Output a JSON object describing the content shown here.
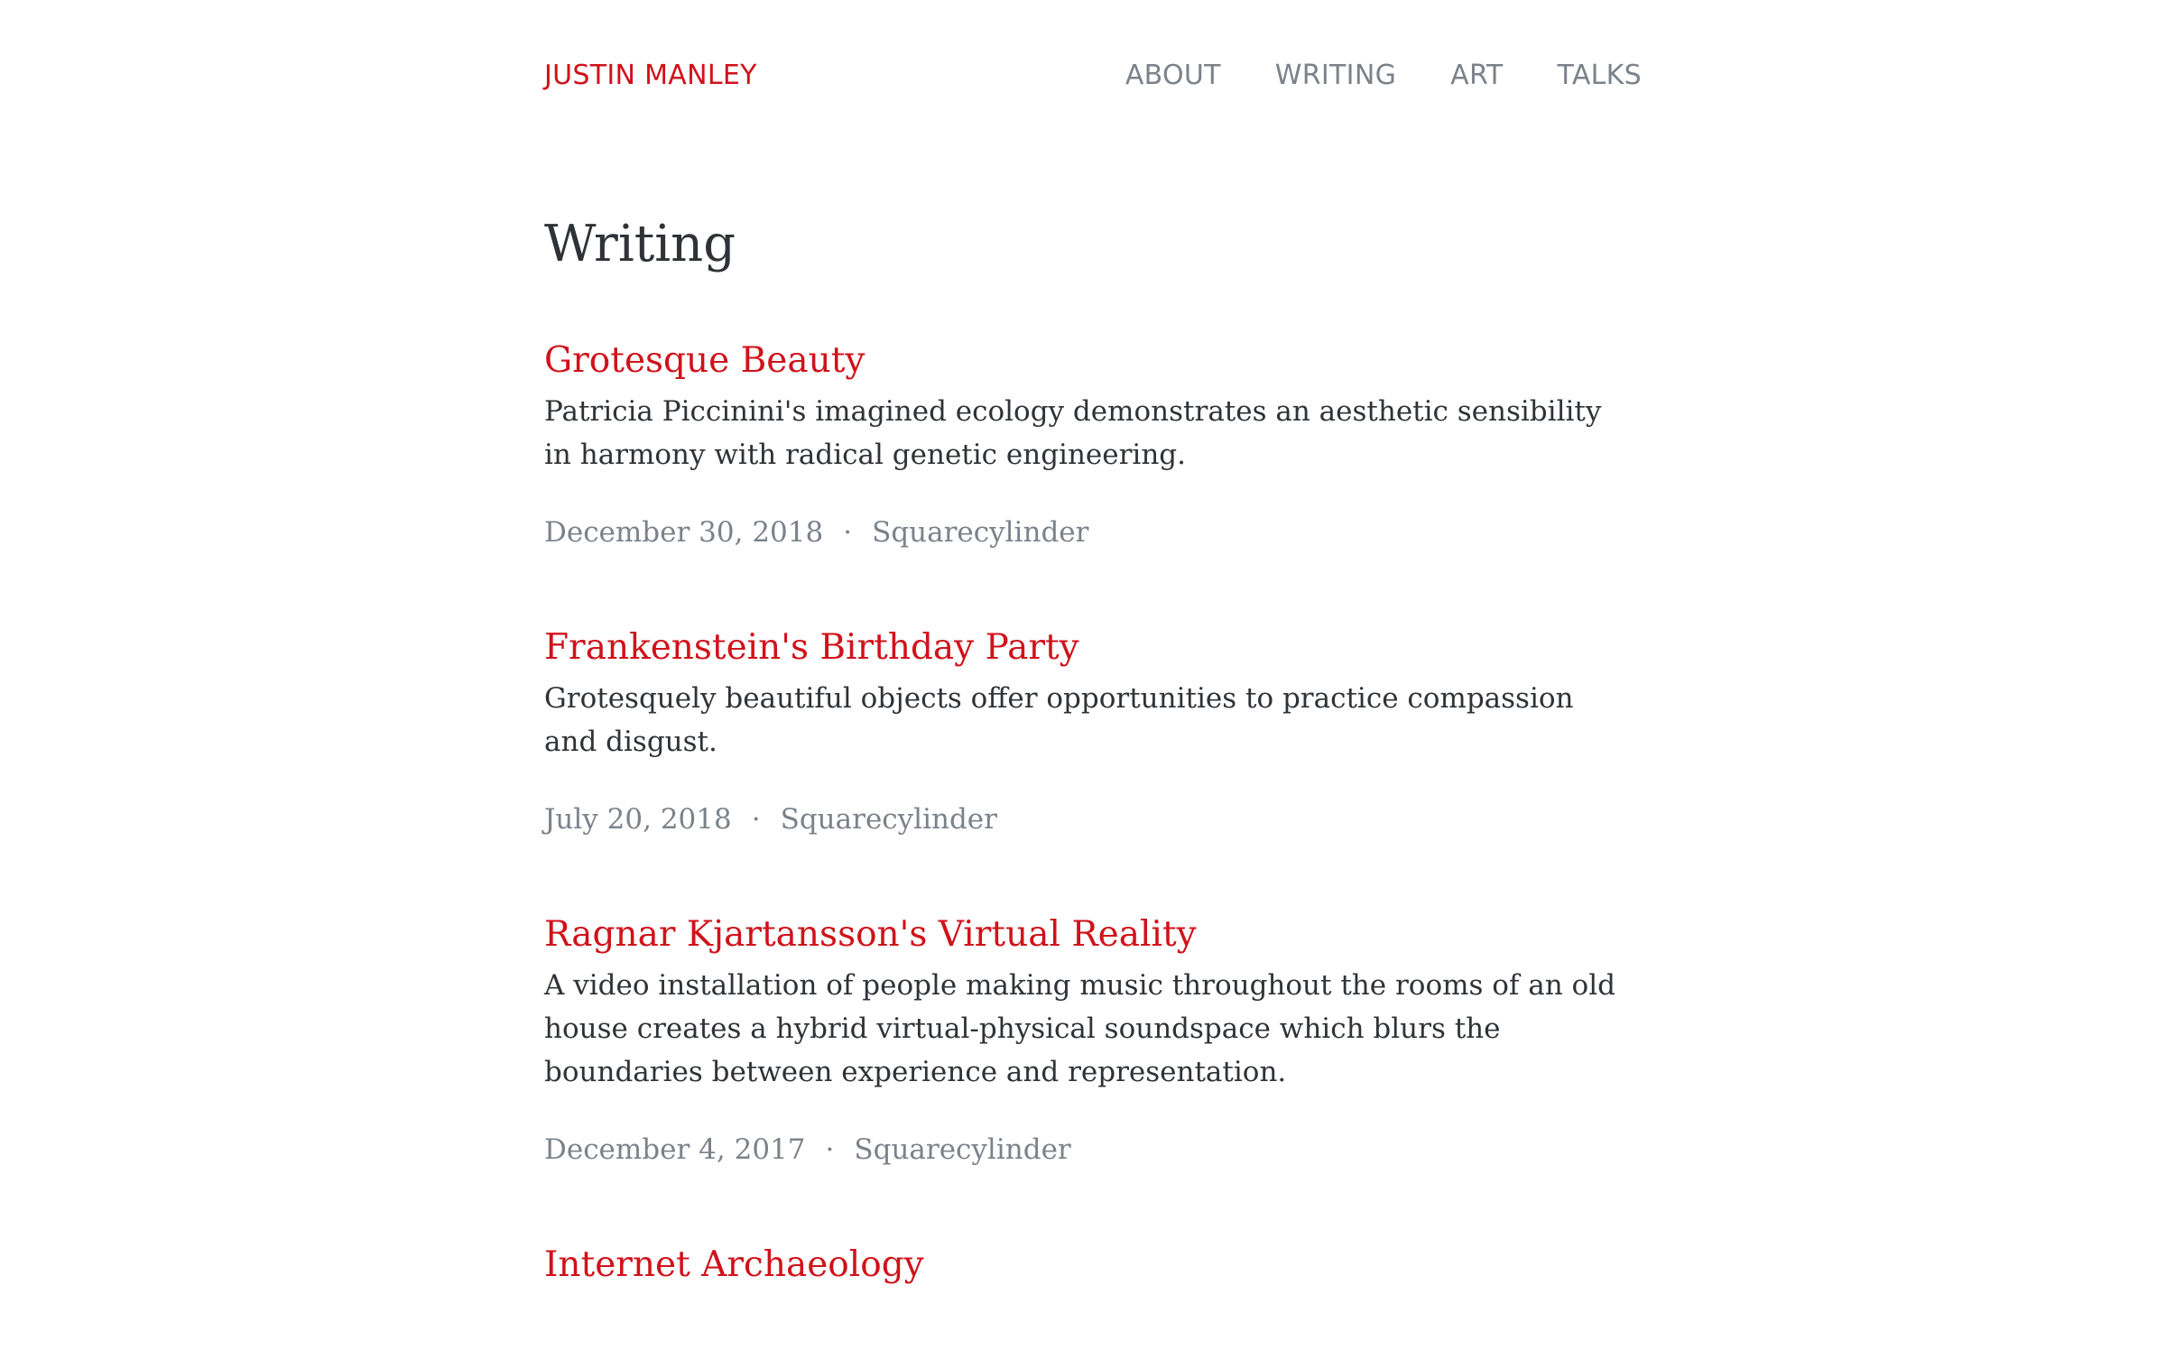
{
  "header": {
    "site_title": "JUSTIN MANLEY",
    "nav": [
      {
        "label": "ABOUT"
      },
      {
        "label": "WRITING"
      },
      {
        "label": "ART"
      },
      {
        "label": "TALKS"
      }
    ]
  },
  "main": {
    "page_title": "Writing",
    "posts": [
      {
        "title": "Grotesque Beauty",
        "excerpt": "Patricia Piccinini's imagined ecology demonstrates an aesthetic sensibility in harmony with radical genetic engineering.",
        "date": "December 30, 2018",
        "separator": "·",
        "source": "Squarecylinder"
      },
      {
        "title": "Frankenstein's Birthday Party",
        "excerpt": "Grotesquely beautiful objects offer opportunities to practice compassion and disgust.",
        "date": "July 20, 2018",
        "separator": "·",
        "source": "Squarecylinder"
      },
      {
        "title": "Ragnar Kjartansson's Virtual Reality",
        "excerpt": "A video installation of people making music throughout the rooms of an old house creates a hybrid virtual-physical soundspace which blurs the boundaries between experience and representation.",
        "date": "December 4, 2017",
        "separator": "·",
        "source": "Squarecylinder"
      },
      {
        "title": "Internet Archaeology"
      }
    ]
  },
  "colors": {
    "accent": "#d0121a",
    "text": "#2f3337",
    "muted": "#7b828a",
    "background": "#ffffff"
  }
}
